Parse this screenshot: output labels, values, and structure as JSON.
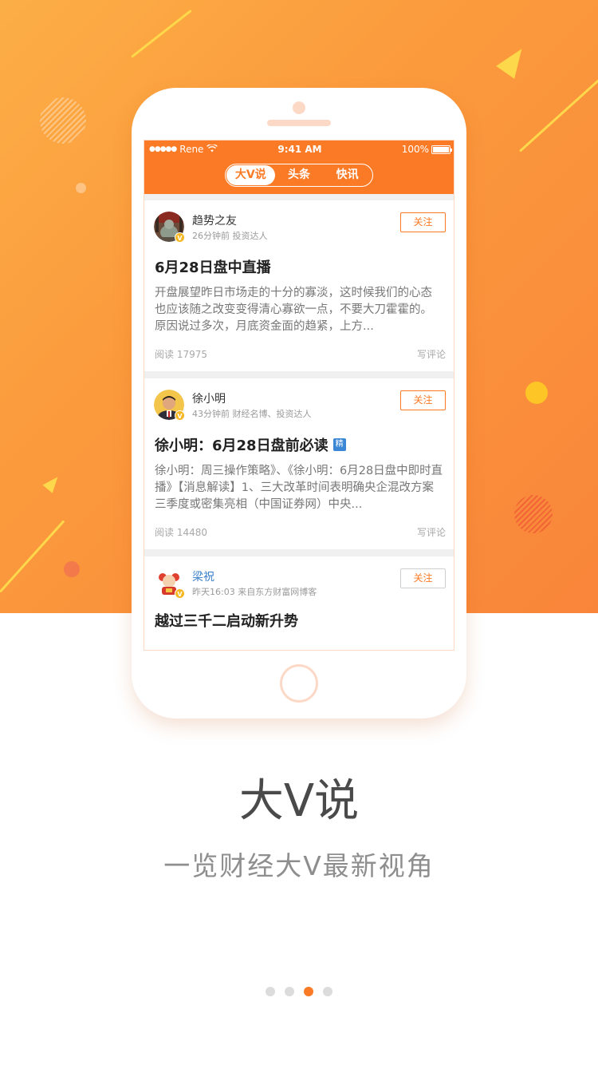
{
  "status_bar": {
    "signal": "●●●●●",
    "carrier": "Rene",
    "time": "9:41 AM",
    "battery": "100%"
  },
  "tabs": [
    {
      "label": "大V说",
      "active": true
    },
    {
      "label": "头条",
      "active": false
    },
    {
      "label": "快讯",
      "active": false
    }
  ],
  "posts": [
    {
      "author": "趋势之友",
      "meta": "26分钟前  投资达人",
      "follow_label": "关注",
      "title": "6月28日盘中直播",
      "excerpt": "开盘展望昨日市场走的十分的寡淡，这时候我们的心态也应该随之改变变得清心寡欲一点，不要大刀霍霍的。原因说过多次，月底资金面的趋紧，上方...",
      "reads": "阅读 17975",
      "comment_label": "写评论"
    },
    {
      "author": "徐小明",
      "meta": "43分钟前  财经名博、投资达人",
      "follow_label": "关注",
      "title": "徐小明：6月28日盘前必读",
      "badge": "精",
      "excerpt": "徐小明：周三操作策略》、《徐小明：6月28日盘中即时直播》【消息解读】1、三大改革时间表明确央企混改方案三季度或密集亮相（中国证券网）中央...",
      "reads": "阅读 14480",
      "comment_label": "写评论"
    },
    {
      "author": "梁祝",
      "meta": "昨天16:03  来自东方财富网博客",
      "follow_label": "关注",
      "title": "越过三千二启动新升势"
    }
  ],
  "badge_v": "V",
  "headline": "大V说",
  "subheadline": "一览财经大V最新视角",
  "pager": {
    "count": 4,
    "active_index": 2
  },
  "colors": {
    "accent": "#fb7a26",
    "hero_start": "#fcae46",
    "hero_end": "#f9853a"
  }
}
